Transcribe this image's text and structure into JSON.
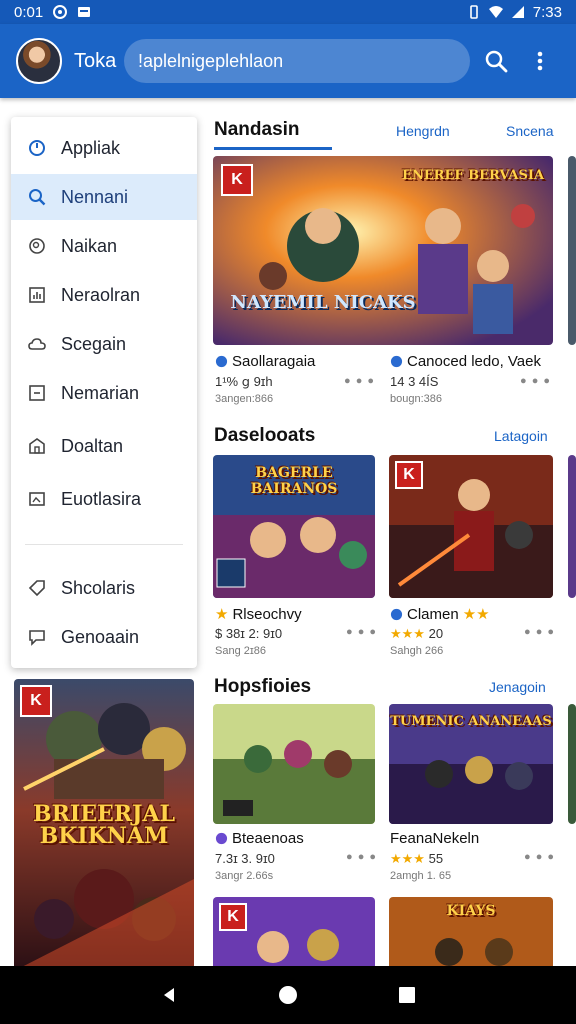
{
  "status_bar": {
    "time_left": "0:01",
    "time_right": "7:33"
  },
  "app_bar": {
    "title": "Toka",
    "search_text": "!aplelnigeplehlaon"
  },
  "drawer": {
    "items": [
      {
        "label": "Appliak",
        "icon": "clock-icon"
      },
      {
        "label": "Nennani",
        "icon": "search-icon"
      },
      {
        "label": "Naikan",
        "icon": "magnifier-circle-icon"
      },
      {
        "label": "Neraolran",
        "icon": "chart-icon"
      },
      {
        "label": "Scegain",
        "icon": "cloud-icon"
      },
      {
        "label": "Nemarian",
        "icon": "box-icon"
      },
      {
        "label": "Doaltan",
        "icon": "home-icon"
      },
      {
        "label": "Euotlasira",
        "icon": "image-icon"
      }
    ],
    "secondary_items": [
      {
        "label": "Shcolaris",
        "icon": "tag-icon"
      },
      {
        "label": "Genoaain",
        "icon": "chat-icon"
      }
    ]
  },
  "sections": [
    {
      "title": "Nandasin",
      "links": [
        "Hengrdn",
        "Sncena"
      ],
      "cards": [
        {
          "title": "Saollaragaia",
          "sub": "1¹% ց 9ɪh",
          "meta": "3angen:866"
        },
        {
          "title": "Canoced ledo, Vaek",
          "sub": "14 3 4ÍS",
          "meta": "bougn:386"
        }
      ]
    },
    {
      "title": "Daselooats",
      "links": [
        "Latagoin"
      ],
      "cards": [
        {
          "title": "Rlseochvy",
          "sub": "$ 38ɪ 2: 9ɪ0",
          "meta": "Sang 2ɪ86"
        },
        {
          "title": "Clamen",
          "sub": "20",
          "meta": "Sahgh 266"
        }
      ]
    },
    {
      "title": "Hopsfioies",
      "links": [
        "Jenagoin"
      ],
      "cards": [
        {
          "title": "Bteaenoas",
          "sub": "7.3ɪ 3. 9ɪ0",
          "meta": "3angr 2.66s"
        },
        {
          "title": "FeanaNekeln",
          "sub": "55",
          "meta": "2amgh 1. 65"
        }
      ]
    }
  ],
  "poster_art": {
    "hero_text": "NAYEMIL NICAKS",
    "game_a": "ENEREF BERVASIA",
    "game_b": "BAGERLE BAIRANOS",
    "game_c": "TUMENIC ANANEAAS",
    "game_d": "KIAYS",
    "poster_left": "BRIEERJAL BKIKNAM"
  },
  "colors": {
    "primary": "#1b64c6",
    "status_bar": "#1559b8",
    "accent_star": "#f2a900"
  }
}
